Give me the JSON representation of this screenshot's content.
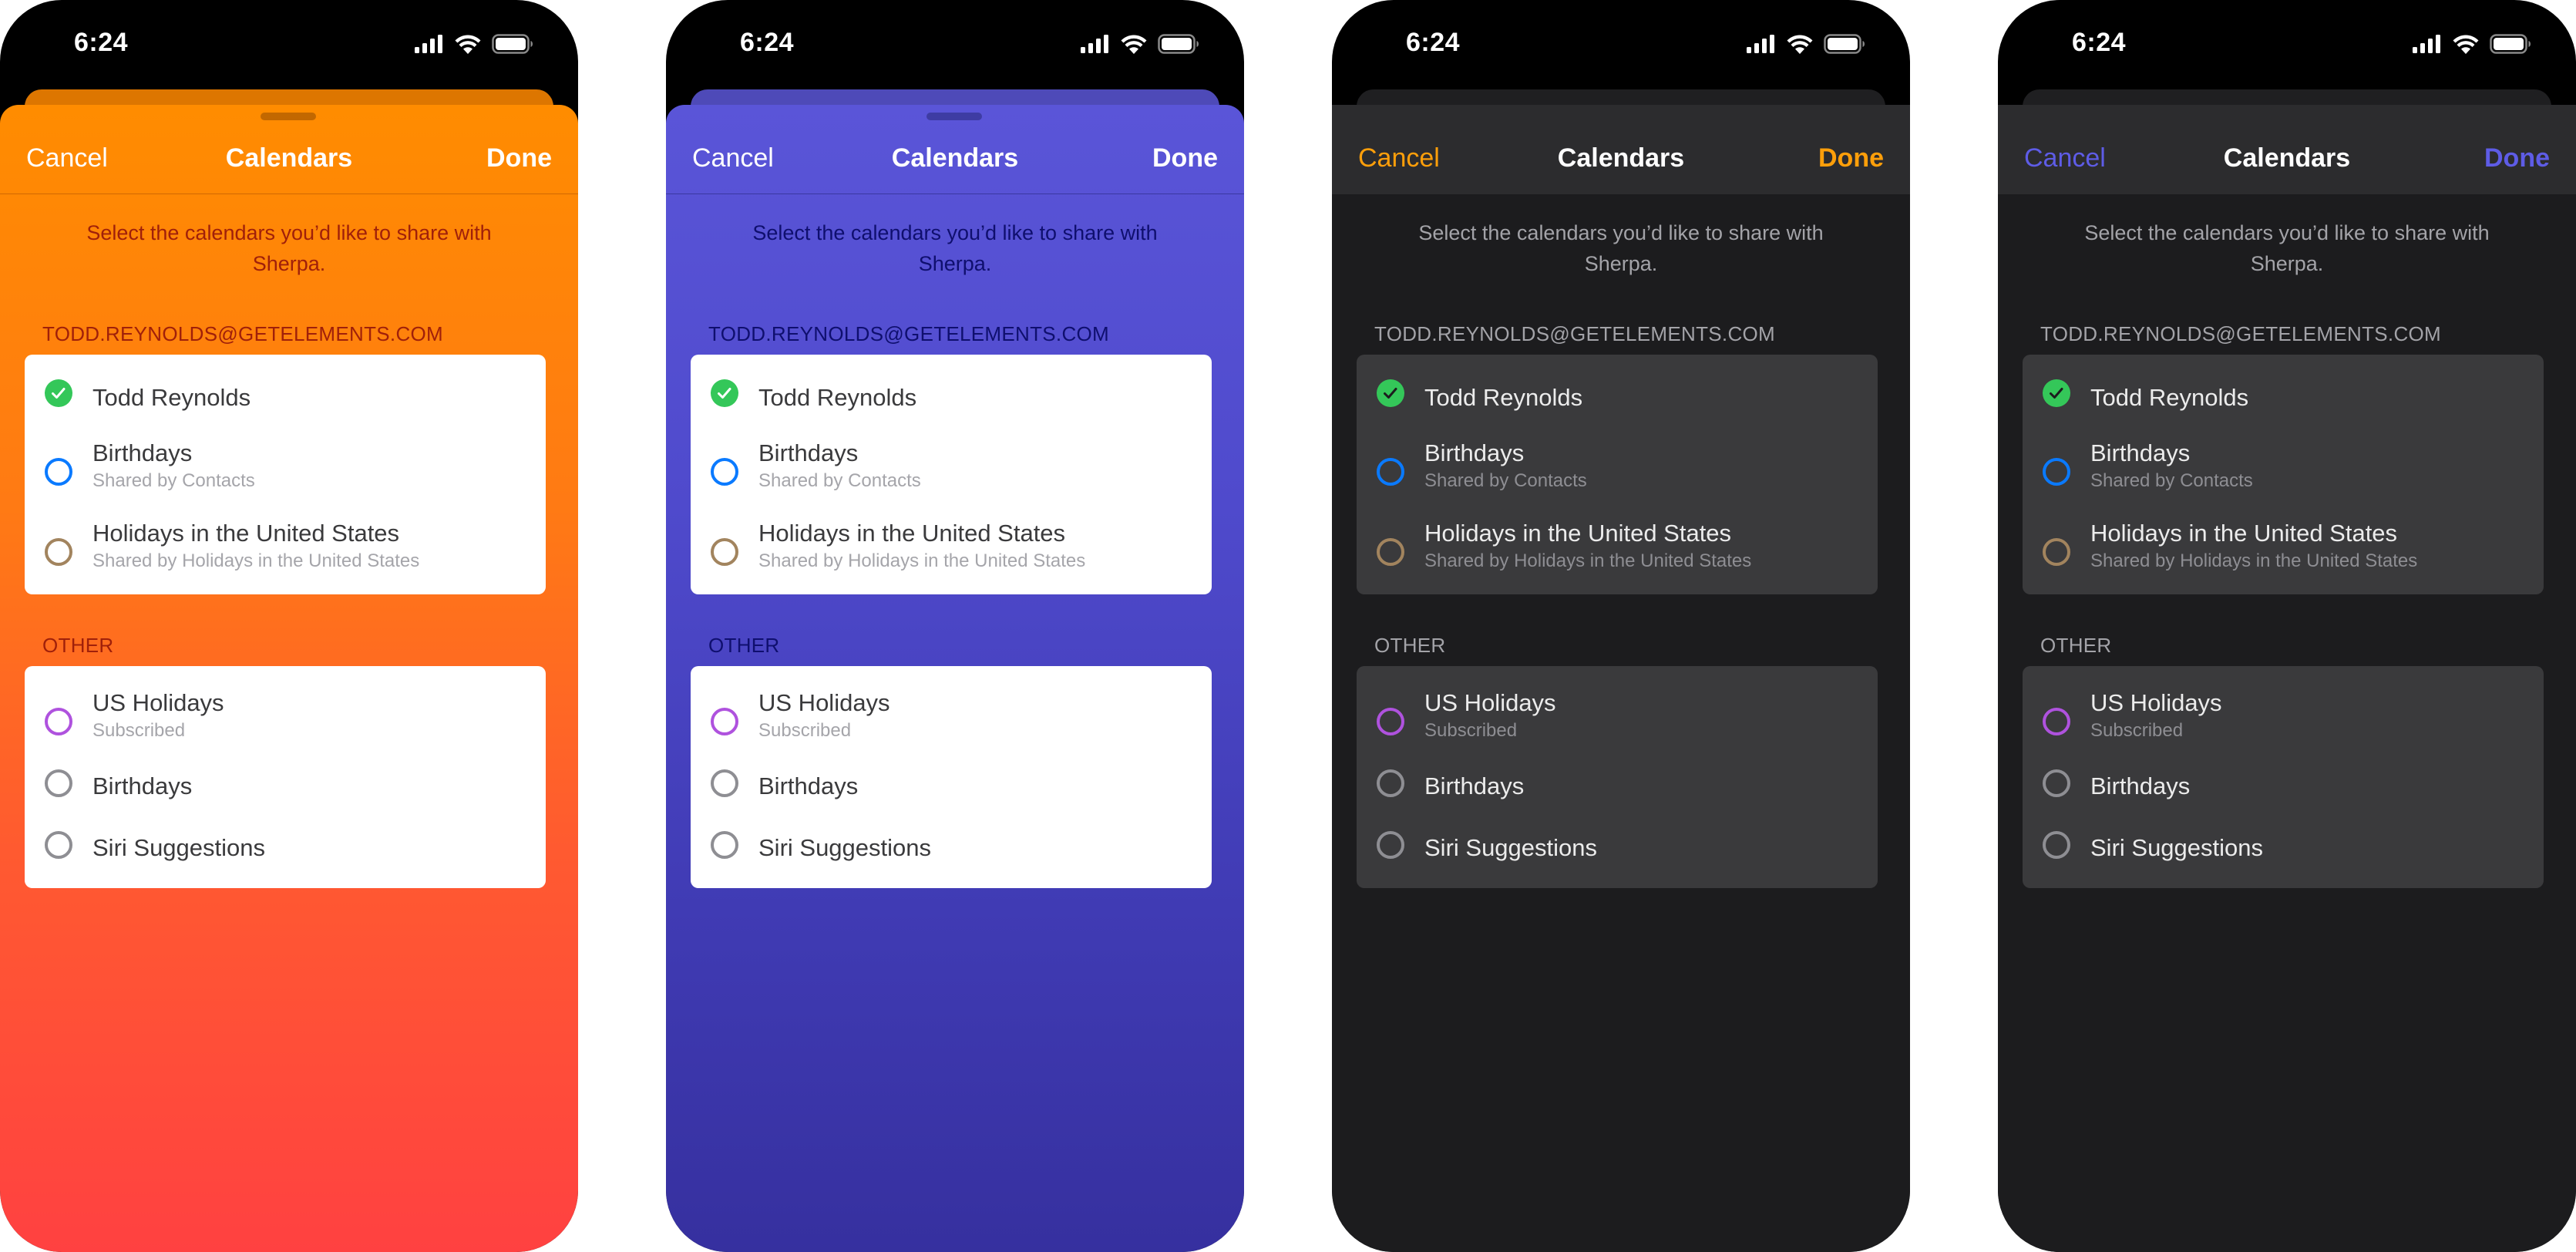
{
  "status_bar": {
    "time": "6:24",
    "icons": [
      "signal-icon",
      "wifi-icon",
      "battery-icon"
    ]
  },
  "sheet": {
    "title": "Calendars",
    "cancel_label": "Cancel",
    "done_label": "Done",
    "intro": "Select the calendars you’d like to share with Sherpa."
  },
  "sections": [
    {
      "header": "TODD.REYNOLDS@GETELEMENTS.COM",
      "items": [
        {
          "title": "Todd Reynolds",
          "subtitle": "",
          "selected": true,
          "color": "#34c759"
        },
        {
          "title": "Birthdays",
          "subtitle": "Shared by Contacts",
          "selected": false,
          "color": "#0a7aff"
        },
        {
          "title": "Holidays in the United States",
          "subtitle": "Shared by Holidays in the United States",
          "selected": false,
          "color": "#a2845e"
        }
      ]
    },
    {
      "header": "OTHER",
      "items": [
        {
          "title": "US Holidays",
          "subtitle": "Subscribed",
          "selected": false,
          "color": "#af52de"
        },
        {
          "title": "Birthdays",
          "subtitle": "",
          "selected": false,
          "color": "#8e8e93"
        },
        {
          "title": "Siri Suggestions",
          "subtitle": "",
          "selected": false,
          "color": "#8e8e93"
        }
      ]
    }
  ],
  "variants": [
    {
      "name": "orange-light",
      "accent": "#ffffff",
      "background_top": "#ff8c00",
      "background_bottom": "#ff4141"
    },
    {
      "name": "indigo-light",
      "accent": "#ffffff",
      "background_top": "#5a55d8",
      "background_bottom": "#36309f"
    },
    {
      "name": "orange-dark",
      "accent": "#ff9f0a",
      "background": "#1c1c1e"
    },
    {
      "name": "indigo-dark",
      "accent": "#5e5ce6",
      "background": "#1c1c1e"
    }
  ]
}
